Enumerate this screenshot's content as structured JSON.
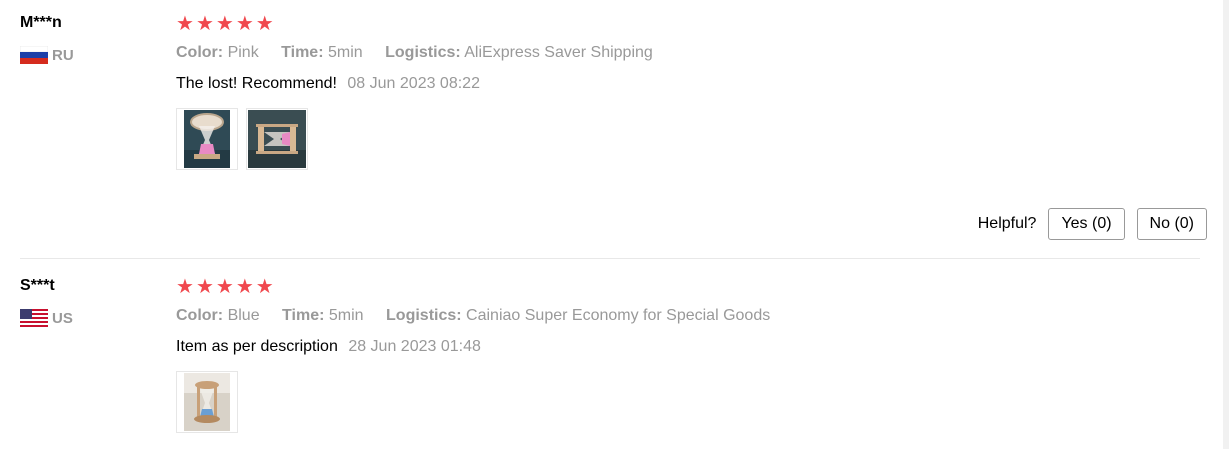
{
  "colors": {
    "star": "#f0484e",
    "muted": "#999999"
  },
  "reviews": [
    {
      "user": "M***n",
      "country_code": "RU",
      "flag": "flag-ru-icon",
      "stars": 5,
      "color_label": "Color:",
      "color_value": "Pink",
      "time_label": "Time:",
      "time_value": "5min",
      "logistics_label": "Logistics:",
      "logistics_value": "AliExpress Saver Shipping",
      "text": "The lost! Recommend!",
      "date": "08 Jun 2023 08:22",
      "photos": [
        "hourglass-pink-photo",
        "hourglass-side-photo"
      ]
    },
    {
      "user": "S***t",
      "country_code": "US",
      "flag": "flag-us-icon",
      "stars": 5,
      "color_label": "Color:",
      "color_value": "Blue",
      "time_label": "Time:",
      "time_value": "5min",
      "logistics_label": "Logistics:",
      "logistics_value": "Cainiao Super Economy for Special Goods",
      "text": "Item as per description",
      "date": "28 Jun 2023 01:48",
      "photos": [
        "hourglass-blue-photo"
      ]
    }
  ],
  "helpful": {
    "label": "Helpful?",
    "yes": "Yes (0)",
    "no": "No (0)"
  }
}
